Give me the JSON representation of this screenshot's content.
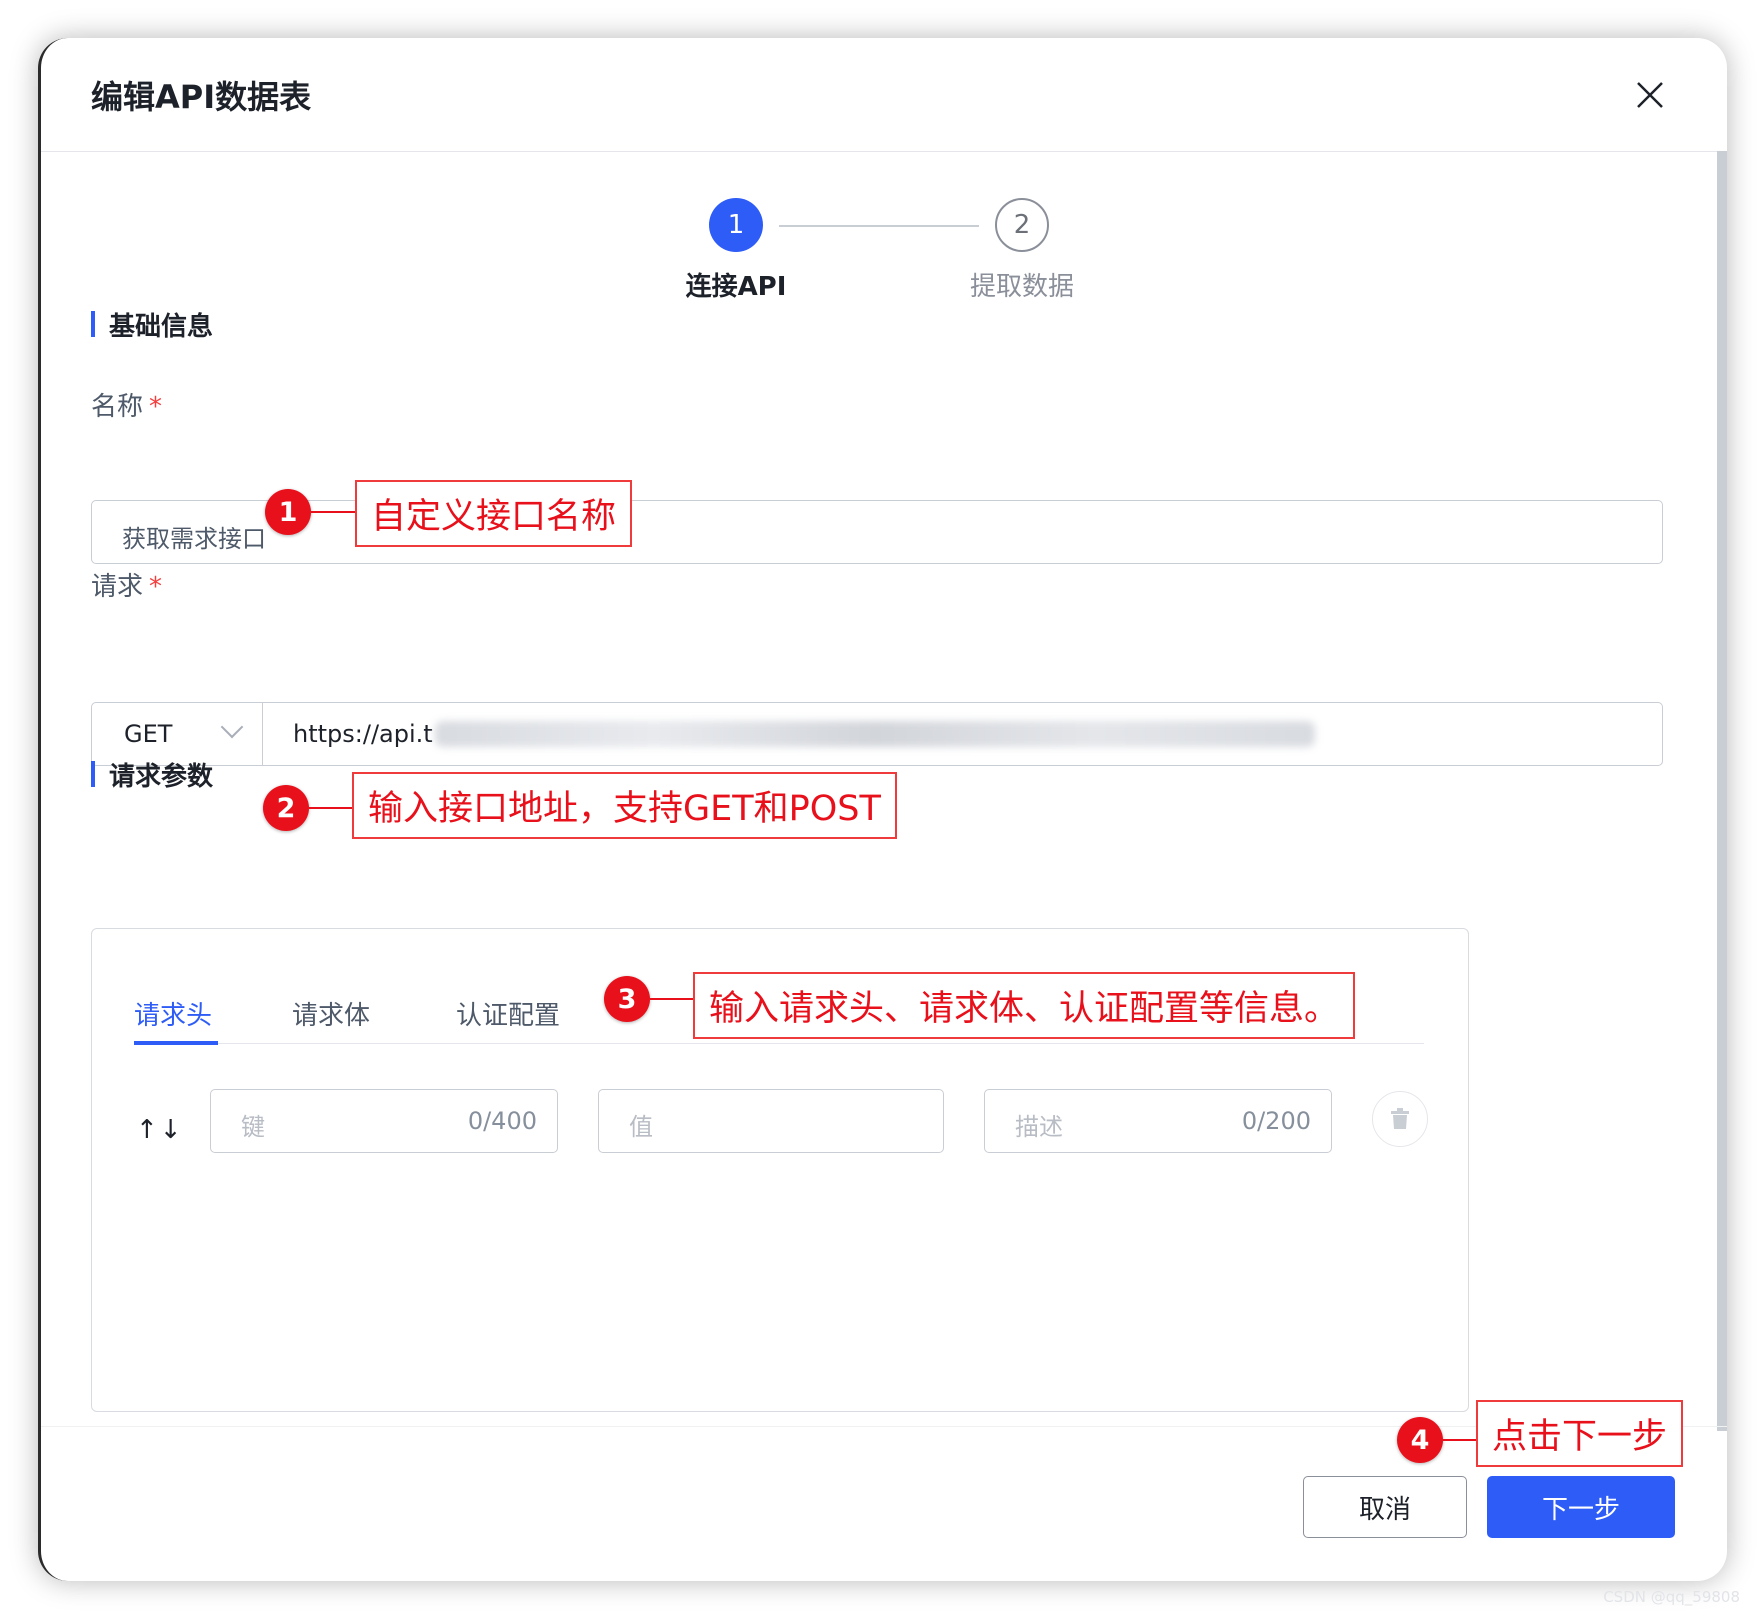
{
  "dialog": {
    "title": "编辑API数据表"
  },
  "steps": [
    {
      "number": "1",
      "label": "连接API",
      "active": true
    },
    {
      "number": "2",
      "label": "提取数据",
      "active": false
    }
  ],
  "basic_info": {
    "section_title": "基础信息",
    "name_label": "名称",
    "name_required": "*",
    "name_value": "获取需求接口"
  },
  "request": {
    "label": "请求",
    "required": "*",
    "method": "GET",
    "url_visible": "https://api.t"
  },
  "params": {
    "section_title": "请求参数",
    "tabs": [
      "请求头",
      "请求体",
      "认证配置"
    ],
    "active_tab": "请求头",
    "sort_label": "↑↓",
    "key_placeholder": "键",
    "key_counter": "0/400",
    "value_placeholder": "值",
    "desc_placeholder": "描述",
    "desc_counter": "0/200"
  },
  "footer": {
    "cancel_label": "取消",
    "next_label": "下一步"
  },
  "annotations": [
    {
      "number": "1",
      "text": "自定义接口名称"
    },
    {
      "number": "2",
      "text": "输入接口地址，支持GET和POST"
    },
    {
      "number": "3",
      "text": "输入请求头、请求体、认证配置等信息。"
    },
    {
      "number": "4",
      "text": "点击下一步"
    }
  ],
  "colors": {
    "primary": "#2e5cf6",
    "annotation_red": "#e8101a",
    "required": "#f53f3f"
  },
  "watermark": "CSDN @qq_59808"
}
